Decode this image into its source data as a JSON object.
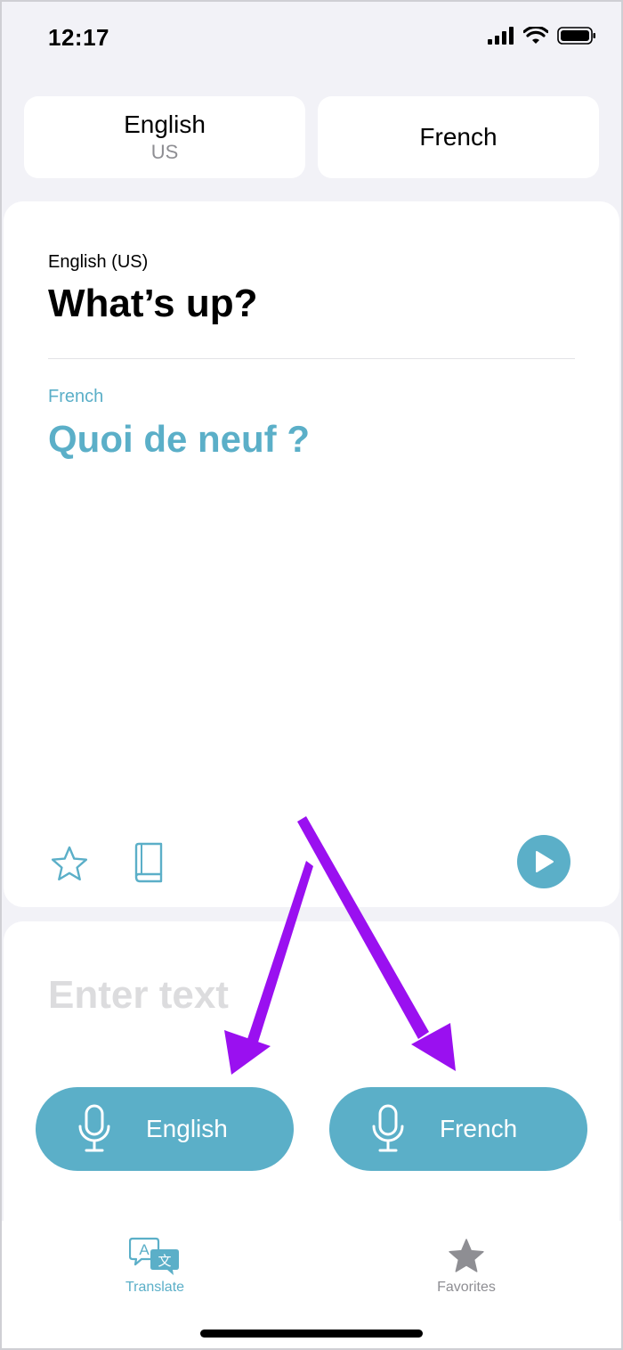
{
  "status_bar": {
    "time": "12:17",
    "icons": [
      "signal-icon",
      "wifi-icon",
      "battery-icon"
    ]
  },
  "language_selector": {
    "source": {
      "name": "English",
      "region": "US"
    },
    "target": {
      "name": "French"
    }
  },
  "translation": {
    "source_label": "English (US)",
    "source_text": "What’s up?",
    "target_label": "French",
    "target_text": "Quoi de neuf ?",
    "actions": [
      "star-icon",
      "book-icon",
      "play-icon"
    ]
  },
  "input": {
    "placeholder": "Enter text"
  },
  "mic_buttons": [
    {
      "label": "English",
      "icon": "microphone-icon"
    },
    {
      "label": "French",
      "icon": "microphone-icon"
    }
  ],
  "tab_bar": {
    "items": [
      {
        "label": "Translate",
        "icon": "translate-icon",
        "selected": true
      },
      {
        "label": "Favorites",
        "icon": "star-filled-icon",
        "selected": false
      }
    ]
  },
  "colors": {
    "accent": "#5bafc8",
    "background": "#f2f2f7",
    "annotation_arrow": "#9a10f0",
    "placeholder": "#dcdcde",
    "inactive_tab": "#8e8e93"
  }
}
